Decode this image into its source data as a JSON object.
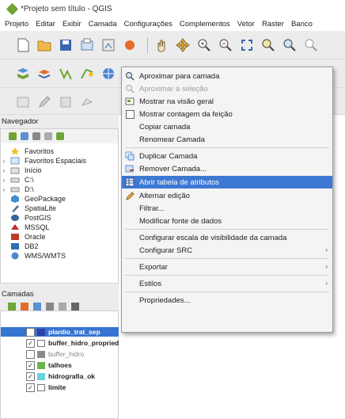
{
  "window": {
    "title": "*Projeto sem título - QGIS"
  },
  "menubar": {
    "items": [
      "Projeto",
      "Editar",
      "Exibir",
      "Camada",
      "Configurações",
      "Complementos",
      "Vetor",
      "Raster",
      "Banco"
    ]
  },
  "browser": {
    "title": "Navegador",
    "items": [
      {
        "label": "Favoritos",
        "icon": "star-icon"
      },
      {
        "label": "Favoritos Espaciais",
        "icon": "spatial-bookmark-icon",
        "expand": "›"
      },
      {
        "label": "Início",
        "icon": "home-folder-icon",
        "expand": "›"
      },
      {
        "label": "C:\\",
        "icon": "drive-icon",
        "expand": "›"
      },
      {
        "label": "D:\\",
        "icon": "drive-icon",
        "expand": "›"
      },
      {
        "label": "GeoPackage",
        "icon": "geopackage-icon"
      },
      {
        "label": "SpatiaLite",
        "icon": "spatialite-icon"
      },
      {
        "label": "PostGIS",
        "icon": "postgis-icon"
      },
      {
        "label": "MSSQL",
        "icon": "mssql-icon"
      },
      {
        "label": "Oracle",
        "icon": "oracle-icon"
      },
      {
        "label": "DB2",
        "icon": "db2-icon"
      },
      {
        "label": "WMS/WMTS",
        "icon": "wms-icon"
      }
    ]
  },
  "layers": {
    "title": "Camadas",
    "items": [
      {
        "label": "plantio_trat_sep",
        "checked": true,
        "color": "#2e3fa6",
        "bold": true,
        "selected": true
      },
      {
        "label": "buffer_hidro_propriedade",
        "checked": true,
        "color": "#ffffff",
        "bold": true,
        "selected": false
      },
      {
        "label": "buffer_hidro",
        "checked": false,
        "color": "#8a8a8a",
        "bold": false,
        "selected": false
      },
      {
        "label": "talhoes",
        "checked": true,
        "color": "#6db44a",
        "bold": true,
        "selected": false
      },
      {
        "label": "hidrografia_ok",
        "checked": true,
        "color": "#69d3df",
        "bold": true,
        "selected": false
      },
      {
        "label": "limite",
        "checked": true,
        "color": "#ffffff",
        "bold": true,
        "selected": false
      }
    ]
  },
  "context_menu": {
    "items": [
      {
        "label": "Aproximar para camada",
        "icon": "zoom-to-layer-icon",
        "enabled": true
      },
      {
        "label": "Aproximar à seleção",
        "icon": "zoom-to-selection-icon",
        "enabled": false
      },
      {
        "label": "Mostrar na visão geral",
        "icon": "overview-icon",
        "enabled": true
      },
      {
        "label": "Mostrar contagem da feição",
        "icon": "checkbox-icon",
        "enabled": true
      },
      {
        "label": "Copiar camada",
        "icon": "",
        "enabled": true
      },
      {
        "label": "Renomear Camada",
        "icon": "",
        "enabled": true
      },
      {
        "label": "Duplicar Camada",
        "icon": "duplicate-layer-icon",
        "enabled": true
      },
      {
        "label": "Remover Camada...",
        "icon": "remove-layer-icon",
        "enabled": true
      },
      {
        "label": "Abrir tabela de atributos",
        "icon": "attribute-table-icon",
        "enabled": true,
        "highlight": true
      },
      {
        "label": "Alternar edição",
        "icon": "pencil-icon",
        "enabled": true
      },
      {
        "label": "Filtrar...",
        "icon": "",
        "enabled": true
      },
      {
        "label": "Modificar fonte de dados",
        "icon": "",
        "enabled": true
      },
      {
        "label": "Configurar escala de visibilidade da camada",
        "icon": "",
        "enabled": true
      },
      {
        "label": "Configurar SRC",
        "icon": "",
        "enabled": true,
        "submenu": "›"
      },
      {
        "label": "Exportar",
        "icon": "",
        "enabled": true,
        "submenu": "›"
      },
      {
        "label": "Estilos",
        "icon": "",
        "enabled": true,
        "submenu": "›"
      },
      {
        "label": "Propriedades...",
        "icon": "",
        "enabled": true
      }
    ]
  },
  "colors": {
    "highlight": "#3c78d4",
    "selection": "#3674d2"
  }
}
